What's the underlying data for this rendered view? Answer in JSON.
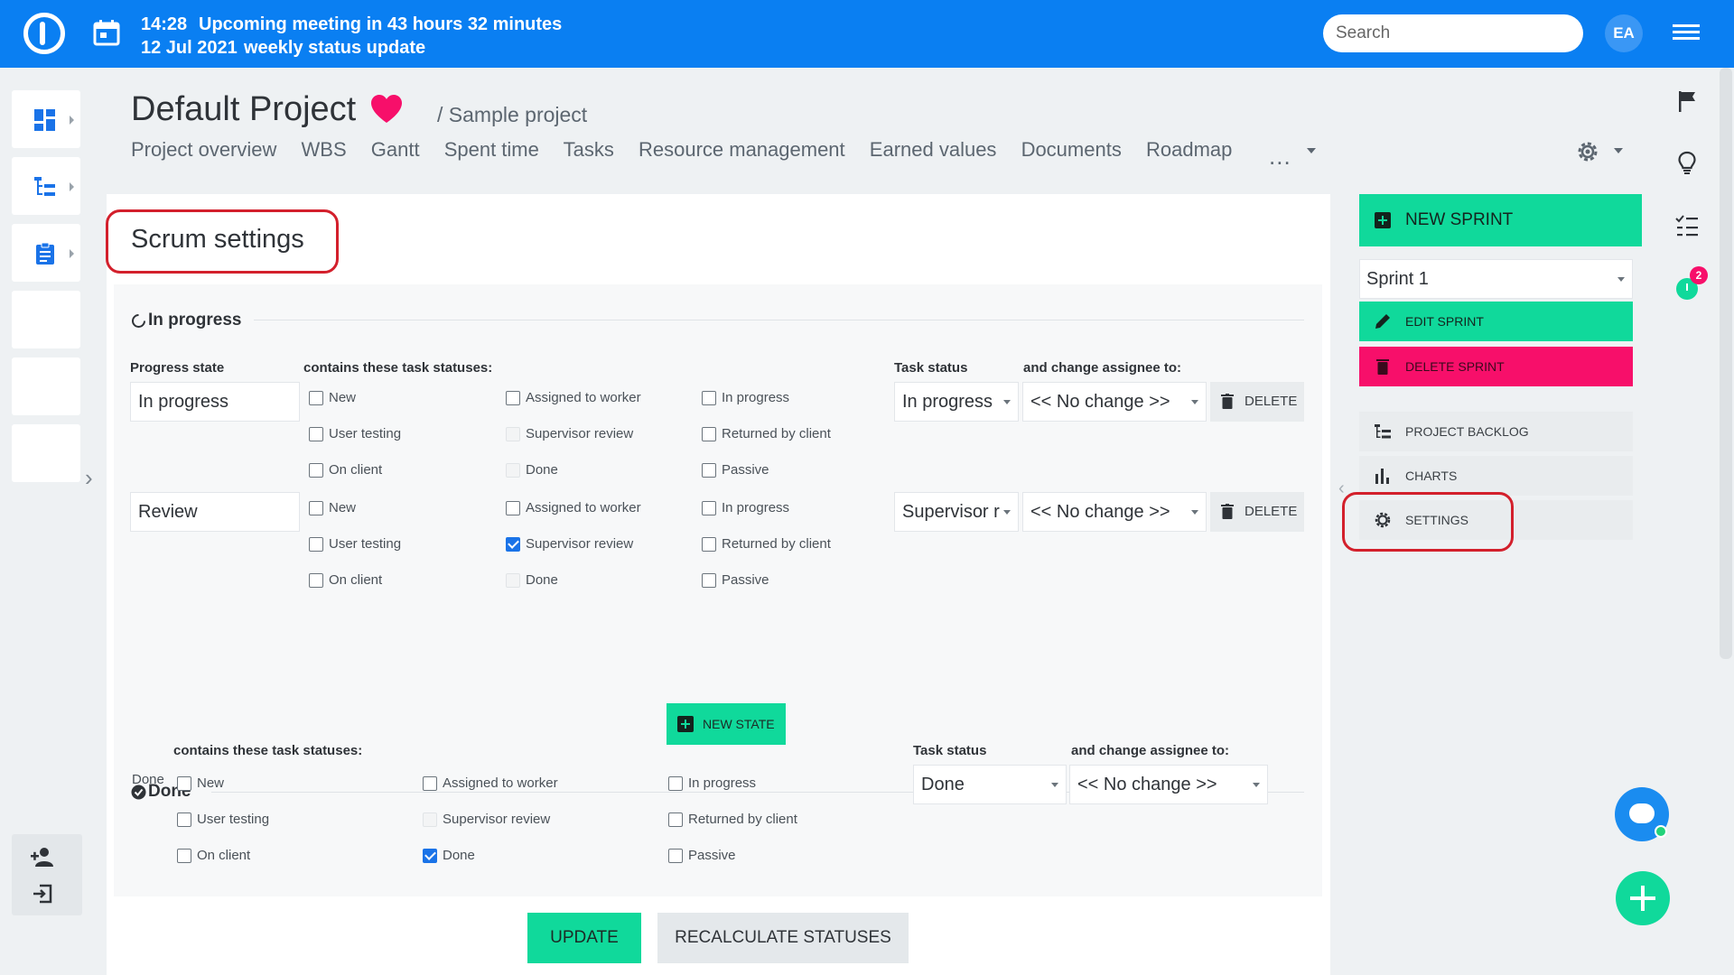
{
  "topbar": {
    "time": "14:28",
    "date": "12 Jul 2021",
    "meeting_line1": "Upcoming meeting in 43 hours 32 minutes",
    "meeting_line2": "weekly status update",
    "search_placeholder": "Search",
    "avatar": "EA"
  },
  "project": {
    "title": "Default Project",
    "subproject": "/ Sample project",
    "nav": [
      "Project overview",
      "WBS",
      "Gantt",
      "Spent time",
      "Tasks",
      "Resource management",
      "Earned values",
      "Documents",
      "Roadmap"
    ],
    "nav_more": "..."
  },
  "settings": {
    "title": "Scrum settings",
    "in_progress_header": "In progress",
    "progress_state_label": "Progress state",
    "contains_label": "contains these task statuses:",
    "task_status_label": "Task status",
    "change_assignee_label": "and change assignee to:",
    "rows": [
      {
        "state": "In progress",
        "statuses": [
          {
            "label": "New",
            "checked": false,
            "disabled": false
          },
          {
            "label": "Assigned to worker",
            "checked": false,
            "disabled": false
          },
          {
            "label": "In progress",
            "checked": false,
            "disabled": false
          },
          {
            "label": "User testing",
            "checked": false,
            "disabled": false
          },
          {
            "label": "Supervisor review",
            "checked": false,
            "disabled": true
          },
          {
            "label": "Returned by client",
            "checked": false,
            "disabled": false
          },
          {
            "label": "On client",
            "checked": false,
            "disabled": false
          },
          {
            "label": "Done",
            "checked": false,
            "disabled": true
          },
          {
            "label": "Passive",
            "checked": false,
            "disabled": false
          }
        ],
        "task_status": "In progress",
        "assignee": "<< No change >>",
        "delete_label": "DELETE"
      },
      {
        "state": "Review",
        "statuses": [
          {
            "label": "New",
            "checked": false,
            "disabled": false
          },
          {
            "label": "Assigned to worker",
            "checked": false,
            "disabled": false
          },
          {
            "label": "In progress",
            "checked": false,
            "disabled": false
          },
          {
            "label": "User testing",
            "checked": false,
            "disabled": false
          },
          {
            "label": "Supervisor review",
            "checked": true,
            "disabled": false
          },
          {
            "label": "Returned by client",
            "checked": false,
            "disabled": false
          },
          {
            "label": "On client",
            "checked": false,
            "disabled": false
          },
          {
            "label": "Done",
            "checked": false,
            "disabled": true
          },
          {
            "label": "Passive",
            "checked": false,
            "disabled": false
          }
        ],
        "task_status": "Supervisor r",
        "assignee": "<< No change >>",
        "delete_label": "DELETE"
      }
    ],
    "new_state_label": "NEW STATE",
    "done_header": "Done",
    "done": {
      "contains_label": "contains these task statuses:",
      "row_label": "Done",
      "statuses": [
        {
          "label": "New",
          "checked": false,
          "disabled": false
        },
        {
          "label": "Assigned to worker",
          "checked": false,
          "disabled": false
        },
        {
          "label": "In progress",
          "checked": false,
          "disabled": false
        },
        {
          "label": "User testing",
          "checked": false,
          "disabled": false
        },
        {
          "label": "Supervisor review",
          "checked": false,
          "disabled": true
        },
        {
          "label": "Returned by client",
          "checked": false,
          "disabled": false
        },
        {
          "label": "On client",
          "checked": false,
          "disabled": false
        },
        {
          "label": "Done",
          "checked": true,
          "disabled": false
        },
        {
          "label": "Passive",
          "checked": false,
          "disabled": false
        }
      ],
      "task_status_label": "Task status",
      "change_assignee_label": "and change assignee to:",
      "task_status": "Done",
      "assignee": "<< No change >>"
    },
    "update_label": "UPDATE",
    "recalculate_label": "RECALCULATE STATUSES"
  },
  "right_panel": {
    "new_sprint": "NEW SPRINT",
    "sprint_select": "Sprint 1",
    "edit_sprint": "EDIT SPRINT",
    "delete_sprint": "DELETE SPRINT",
    "project_backlog": "PROJECT BACKLOG",
    "charts": "CHARTS",
    "settings": "SETTINGS"
  },
  "notifications": {
    "timer_badge": "2"
  },
  "colors": {
    "topbar": "#0a7ff2",
    "accent_green": "#10d99b",
    "accent_pink": "#f70f6a",
    "highlight_red": "#d3202c"
  }
}
